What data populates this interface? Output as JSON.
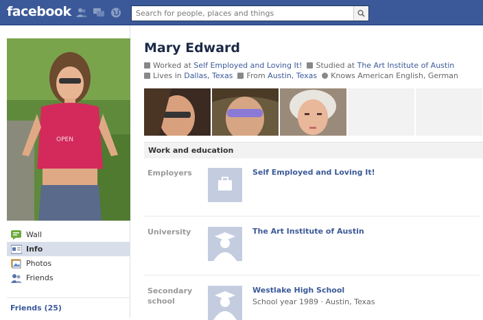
{
  "topbar": {
    "logo": "facebook",
    "search_placeholder": "Search for people, places and things"
  },
  "profile": {
    "name": "Mary Edward",
    "worked_prefix": "Worked at ",
    "worked_at": "Self Employed and Loving It!",
    "studied_prefix": "Studied at ",
    "studied_at": "The Art Institute of Austin",
    "lives_prefix": "Lives in ",
    "lives_in": "Dallas, Texas",
    "from_prefix": "From ",
    "from": "Austin, Texas",
    "knows": "Knows American English, German"
  },
  "nav": {
    "items": [
      {
        "label": "Wall"
      },
      {
        "label": "Info"
      },
      {
        "label": "Photos"
      },
      {
        "label": "Friends"
      }
    ],
    "friends_link": "Friends (25)"
  },
  "section": {
    "title": "Work and education",
    "rows": [
      {
        "label": "Employers",
        "title": "Self Employed and Loving It!",
        "sub": ""
      },
      {
        "label": "University",
        "title": "The Art Institute of Austin",
        "sub": ""
      },
      {
        "label": "Secondary school",
        "title": "Westlake High School",
        "sub": "School year 1989 · Austin, Texas"
      }
    ]
  },
  "colors": {
    "brand": "#3b5998",
    "link": "#3b5998"
  }
}
